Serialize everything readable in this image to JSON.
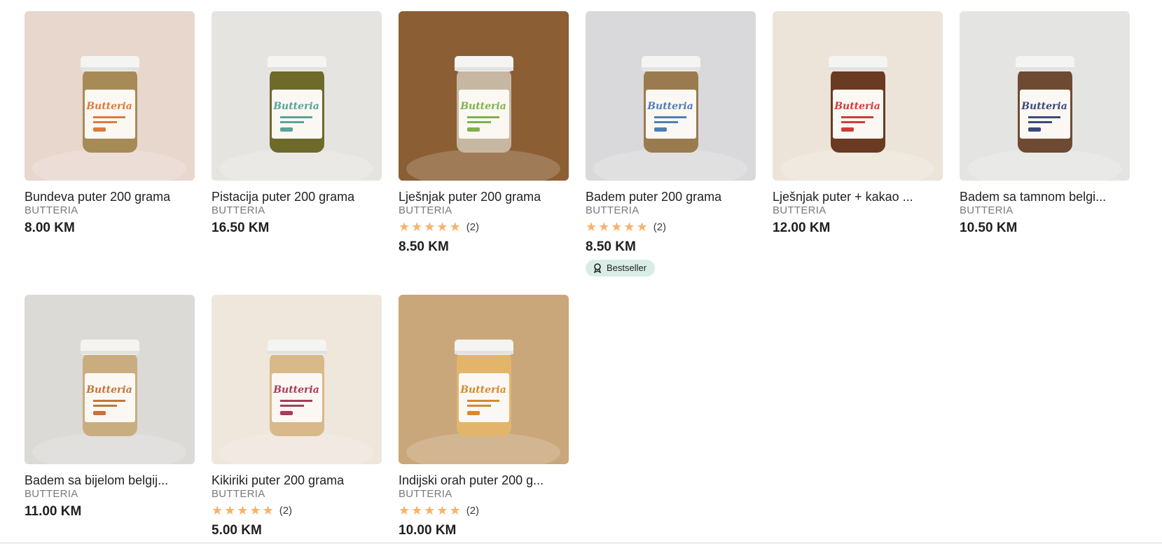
{
  "products": [
    {
      "title": "Bundeva puter 200 grama",
      "brand": "BUTTERIA",
      "price": "8.00 KM",
      "rating": null,
      "badge": null,
      "bg": "#e8d7cd",
      "jar_fill": "#a78b57",
      "label_accent": "#e07a3a"
    },
    {
      "title": "Pistacija puter 200 grama",
      "brand": "BUTTERIA",
      "price": "16.50 KM",
      "rating": null,
      "badge": null,
      "bg": "#e6e4e1",
      "jar_fill": "#6e6a2a",
      "label_accent": "#5aa39a"
    },
    {
      "title": "Lješnjak puter 200 grama",
      "brand": "BUTTERIA",
      "price": "8.50 KM",
      "rating": {
        "stars": 5,
        "count": "(2)"
      },
      "badge": null,
      "bg": "#8b5e34",
      "jar_fill": "#c6b7a2",
      "label_accent": "#7fb24a"
    },
    {
      "title": "Badem puter 200 grama",
      "brand": "BUTTERIA",
      "price": "8.50 KM",
      "rating": {
        "stars": 5,
        "count": "(2)"
      },
      "badge": "Bestseller",
      "bg": "#d9d9db",
      "jar_fill": "#9a7b4f",
      "label_accent": "#4f7fb6"
    },
    {
      "title": "Lješnjak puter + kakao ...",
      "brand": "BUTTERIA",
      "price": "12.00 KM",
      "rating": null,
      "badge": null,
      "bg": "#ece4d8",
      "jar_fill": "#6b3a22",
      "label_accent": "#d23b3b"
    },
    {
      "title": "Badem sa tamnom belgi...",
      "brand": "BUTTERIA",
      "price": "10.50 KM",
      "rating": null,
      "badge": null,
      "bg": "#e4e4e2",
      "jar_fill": "#6e4a33",
      "label_accent": "#3b4a7a"
    },
    {
      "title": "Badem sa bijelom belgij...",
      "brand": "BUTTERIA",
      "price": "11.00 KM",
      "rating": null,
      "badge": null,
      "bg": "#dcdad7",
      "jar_fill": "#c9ad7f",
      "label_accent": "#c4733b"
    },
    {
      "title": "Kikiriki puter 200 grama",
      "brand": "BUTTERIA",
      "price": "5.00 KM",
      "rating": {
        "stars": 5,
        "count": "(2)"
      },
      "badge": null,
      "bg": "#efe6dc",
      "jar_fill": "#d9b98a",
      "label_accent": "#a83a5e"
    },
    {
      "title": "Indijski orah puter 200 g...",
      "brand": "BUTTERIA",
      "price": "10.00 KM",
      "rating": {
        "stars": 5,
        "count": "(2)"
      },
      "badge": null,
      "bg": "#c9a77b",
      "jar_fill": "#e2b56a",
      "label_accent": "#d6892e"
    }
  ],
  "label_text": "Butteria",
  "colors": {
    "star": "#f6b26b",
    "badge_bg": "#d9ede6"
  }
}
